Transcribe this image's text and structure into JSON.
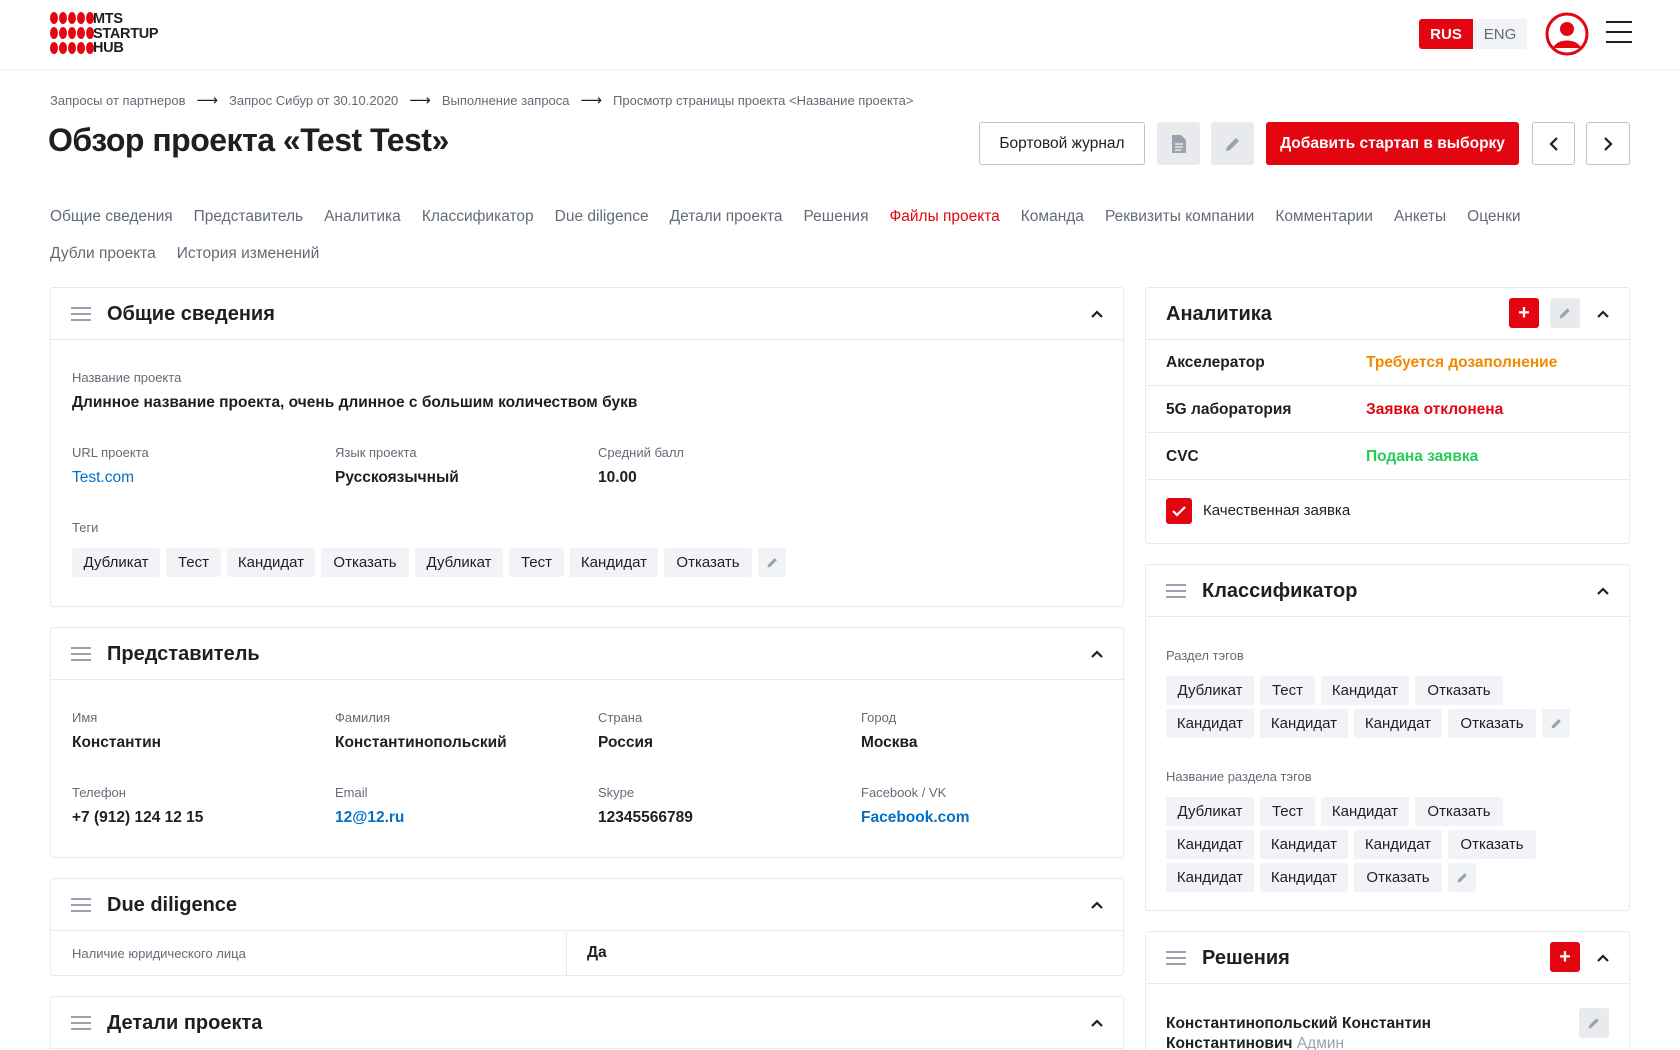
{
  "header": {
    "logo_lines": [
      "MTS",
      "STARTUP",
      "HUB"
    ],
    "lang_rus": "RUS",
    "lang_eng": "ENG"
  },
  "breadcrumbs": [
    "Запросы от партнеров",
    "Запрос Сибур от 30.10.2020",
    "Выполнение запроса",
    "Просмотр страницы проекта <Название проекта>"
  ],
  "page_title": "Обзор проекта «Test Test»",
  "actions": {
    "log_label": "Бортовой журнал",
    "add_label": "Добавить стартап в выборку"
  },
  "tabs": {
    "row1": [
      "Общие сведения",
      "Представитель",
      "Аналитика",
      "Классификатор",
      "Due diligence",
      "Детали проекта",
      "Решения",
      "Файлы проекта",
      "Команда",
      "Реквизиты компании",
      "Комментарии",
      "Анкеты",
      "Оценки"
    ],
    "row2": [
      "Дубли проекта",
      "История изменений"
    ],
    "active": "Файлы проекта"
  },
  "general": {
    "title": "Общие сведения",
    "name_label": "Название проекта",
    "name_value": "Длинное название проекта, очень длинное с большим количеством букв",
    "url_label": "URL проекта",
    "url_value": "Test.com",
    "lang_label": "Язык проекта",
    "lang_value": "Русскоязычный",
    "score_label": "Средний балл",
    "score_value": "10.00",
    "tags_label": "Теги",
    "tags": [
      "Дубликат",
      "Тест",
      "Кандидат",
      "Отказать",
      "Дубликат",
      "Тест",
      "Кандидат",
      "Отказать"
    ]
  },
  "rep": {
    "title": "Представитель",
    "first_label": "Имя",
    "first_value": "Константин",
    "last_label": "Фамилия",
    "last_value": "Константинопольский",
    "country_label": "Страна",
    "country_value": "Россия",
    "city_label": "Город",
    "city_value": "Москва",
    "phone_label": "Телефон",
    "phone_value": "+7 (912) 124 12 15",
    "email_label": "Email",
    "email_value": "12@12.ru",
    "skype_label": "Skype",
    "skype_value": "12345566789",
    "fb_label": "Facebook / VK",
    "fb_value": "Facebook.com"
  },
  "dd": {
    "title": "Due diligence",
    "legal_label": "Наличие юридического лица",
    "legal_value": "Да"
  },
  "details": {
    "title": "Детали проекта"
  },
  "analytics": {
    "title": "Аналитика",
    "rows": [
      {
        "key": "Акселератор",
        "status": "Требуется дозаполнение",
        "color": "#f18a01"
      },
      {
        "key": "5G лаборатория",
        "status": "Заявка отклонена",
        "color": "#e30611"
      },
      {
        "key": "CVC",
        "status": "Подана заявка",
        "color": "#26cd58"
      }
    ],
    "quality_label": "Качественная заявка",
    "quality_checked": true
  },
  "classifier": {
    "title": "Классификатор",
    "section1_label": "Раздел тэгов",
    "section1_tags": [
      "Дубликат",
      "Тест",
      "Кандидат",
      "Отказать",
      "Кандидат",
      "Кандидат",
      "Кандидат",
      "Отказать"
    ],
    "section2_label": "Название раздела тэгов",
    "section2_tags": [
      "Дубликат",
      "Тест",
      "Кандидат",
      "Отказать",
      "Кандидат",
      "Кандидат",
      "Кандидат",
      "Отказать",
      "Кандидат",
      "Кандидат",
      "Отказать"
    ]
  },
  "decisions": {
    "title": "Решения",
    "person": "Константинопольский Константин",
    "person2": "Константинович",
    "role": "Админ"
  },
  "colors": {
    "accent": "#e30611",
    "link": "#0070c9",
    "muted": "#626c77"
  }
}
